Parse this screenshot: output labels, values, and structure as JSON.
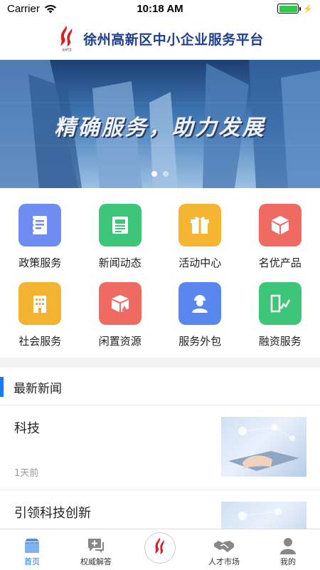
{
  "status_bar": {
    "carrier": "Carrier",
    "time": "10:18 AM"
  },
  "header": {
    "title": "徐州高新区中小企业服务平台",
    "logo_text": "XHTZ"
  },
  "banner": {
    "slogan": "精确服务，助力发展",
    "slide_count": 2,
    "active_slide": 0
  },
  "services": [
    {
      "label": "政策服务",
      "icon": "notebook-icon",
      "color": "#6f8cf2"
    },
    {
      "label": "新闻动态",
      "icon": "newspaper-icon",
      "color": "#3dc67a"
    },
    {
      "label": "活动中心",
      "icon": "gift-icon",
      "color": "#f5b530"
    },
    {
      "label": "名优产品",
      "icon": "cube-icon",
      "color": "#ef6a63"
    },
    {
      "label": "社会服务",
      "icon": "building-icon",
      "color": "#f4b32f"
    },
    {
      "label": "闲置资源",
      "icon": "box-icon",
      "color": "#ef6a63"
    },
    {
      "label": "服务外包",
      "icon": "worker-icon",
      "color": "#5a86f0"
    },
    {
      "label": "融资服务",
      "icon": "finance-icon",
      "color": "#3dc67a"
    }
  ],
  "news_section": {
    "title": "最新新闻"
  },
  "news": [
    {
      "title": "科技",
      "time": "1天前"
    },
    {
      "title": "引领科技创新",
      "time": ""
    }
  ],
  "tabs": [
    {
      "label": "首页",
      "icon": "home-icon",
      "active": true
    },
    {
      "label": "权威解答",
      "icon": "chat-plus-icon",
      "active": false
    },
    {
      "label": "",
      "icon": "logo-icon",
      "active": false
    },
    {
      "label": "人才市场",
      "icon": "handshake-icon",
      "active": false
    },
    {
      "label": "我的",
      "icon": "person-icon",
      "active": false
    }
  ],
  "colors": {
    "accent": "#1e7af0",
    "header_title": "#1d3f8c",
    "logo_red": "#d7201f"
  }
}
